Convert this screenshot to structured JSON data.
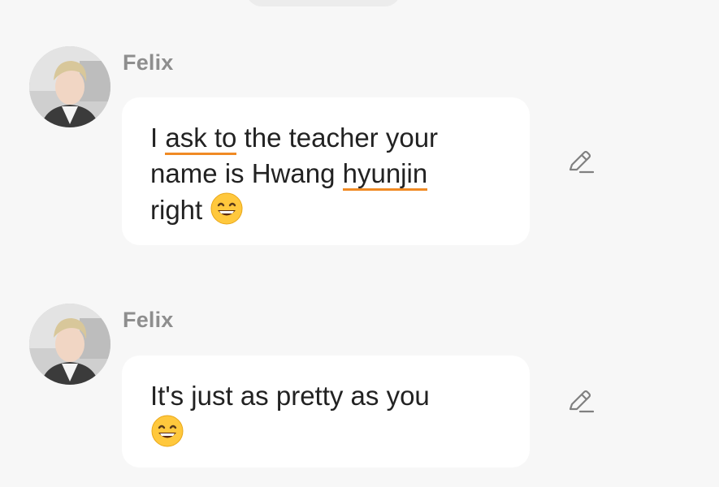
{
  "messages": [
    {
      "sender": "Felix",
      "lines": [
        {
          "pre": "I ",
          "hl": "ask to",
          "post": " the teacher your"
        },
        {
          "pre": "name is Hwang ",
          "hl": "hyunjin",
          "post": ""
        },
        {
          "pre": "right ",
          "hl": "",
          "post": ""
        }
      ],
      "trailing_emoji": "grinning-face-emoji",
      "edit_icon": "pencil-icon"
    },
    {
      "sender": "Felix",
      "lines": [
        {
          "pre": "It's just as pretty as you",
          "hl": "",
          "post": ""
        }
      ],
      "trailing_emoji": "grinning-face-emoji",
      "edit_icon": "pencil-icon"
    }
  ],
  "colors": {
    "background": "#f7f7f7",
    "bubble": "#ffffff",
    "highlight_underline": "#f08a24",
    "sender_text": "#8e8e8e"
  }
}
